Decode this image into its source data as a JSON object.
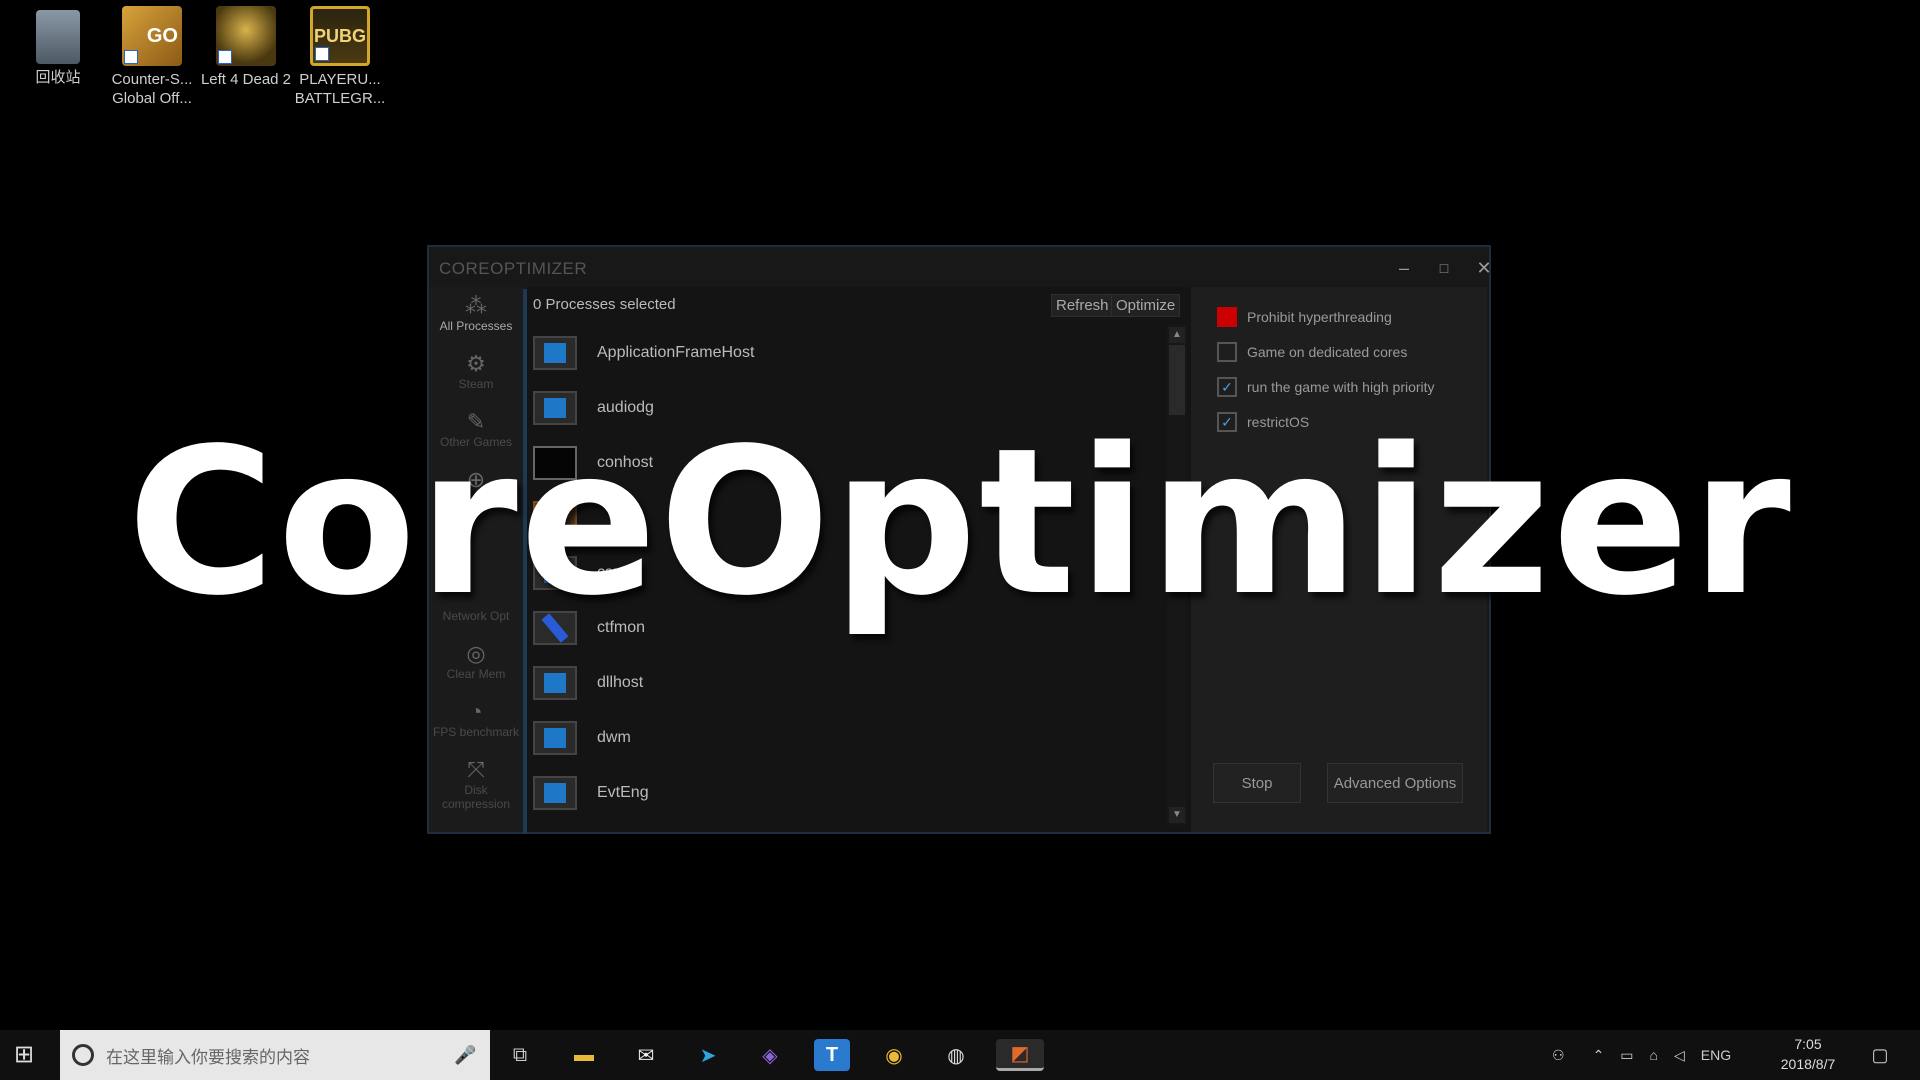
{
  "desktop": {
    "icons": [
      {
        "label": "回收站",
        "icon": "recycle-bin-icon"
      },
      {
        "label": "Counter-S... Global Off...",
        "icon": "csgo-icon",
        "badge": "GO"
      },
      {
        "label": "Left 4 Dead 2",
        "icon": "l4d2-icon"
      },
      {
        "label": "PLAYERU... BATTLEGR...",
        "icon": "pubg-icon",
        "badge": "PUBG"
      }
    ]
  },
  "window": {
    "title": "COREOPTIMIZER",
    "controls": {
      "minimize": "–",
      "maximize": "□",
      "close": "✕"
    }
  },
  "sidebar": {
    "items": [
      {
        "label": "All Processes",
        "icon": "processes-icon"
      },
      {
        "label": "Steam",
        "icon": "steam-icon"
      },
      {
        "label": "Other Games",
        "icon": "gamepad-icon"
      },
      {
        "label": "Cores Opt",
        "icon": "crosshair-icon"
      },
      {
        "label": "",
        "icon": "blank-icon"
      },
      {
        "label": "Network Opt",
        "icon": "network-icon"
      },
      {
        "label": "Clear Mem",
        "icon": "memory-icon"
      },
      {
        "label": "FPS benchmark",
        "icon": "gauge-icon"
      },
      {
        "label": "Disk compression",
        "icon": "compress-icon"
      }
    ]
  },
  "processes": {
    "selected_text": "0 Processes selected",
    "refresh_label": "Refresh",
    "optimize_label": "Optimize",
    "items": [
      {
        "name": "ApplicationFrameHost",
        "icon": "window-icon"
      },
      {
        "name": "audiodg",
        "icon": "window-icon"
      },
      {
        "name": "conhost",
        "icon": "console-icon"
      },
      {
        "name": "",
        "icon": "app-icon"
      },
      {
        "name": "csrss",
        "icon": "window-icon"
      },
      {
        "name": "ctfmon",
        "icon": "pen-icon"
      },
      {
        "name": "dllhost",
        "icon": "window-icon"
      },
      {
        "name": "dwm",
        "icon": "window-icon"
      },
      {
        "name": "EvtEng",
        "icon": "window-icon"
      }
    ]
  },
  "options": {
    "checkboxes": [
      {
        "label": "Prohibit hyperthreading",
        "state": "red"
      },
      {
        "label": "Game on dedicated cores",
        "state": "unchecked"
      },
      {
        "label": "run the game with high priority",
        "state": "checked"
      },
      {
        "label": "restrictOS",
        "state": "checked"
      }
    ],
    "stop_label": "Stop",
    "advanced_label": "Advanced Options"
  },
  "overlay_title": "CoreOptimizer",
  "taskbar": {
    "search_placeholder": "在这里输入你要搜索的内容",
    "apps": [
      "task-view-icon",
      "file-explorer-icon",
      "mail-icon",
      "telegram-icon",
      "visual-studio-icon",
      "t-app-icon",
      "chrome-icon",
      "ball-app-icon",
      "coreoptimizer-icon"
    ],
    "language": "ENG",
    "time": "7:05",
    "date": "2018/8/7"
  },
  "colors": {
    "accent": "#1f77c8",
    "danger": "#cc0000",
    "bg": "#000000"
  }
}
